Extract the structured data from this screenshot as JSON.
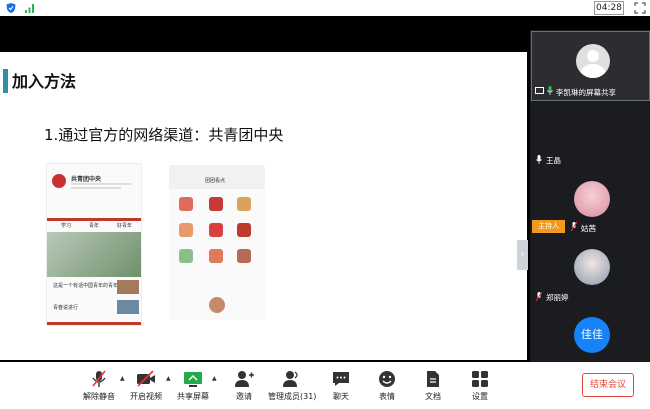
{
  "topbar": {
    "time": "04:28"
  },
  "slide": {
    "title": "加入方法",
    "subtitle": "1.通过官方的网络渠道：共青团中央",
    "phone1": {
      "account_name": "共青团中央",
      "tabs": [
        "学习",
        "青年",
        "好青年"
      ],
      "item1": "这是一个有话中国青年的青年情感",
      "item2": "青春说进行"
    },
    "phone2": {
      "title": "团团看点"
    }
  },
  "participants": [
    {
      "name": "李凯琳的屏幕共享"
    },
    {
      "name": "王晶"
    },
    {
      "name": "姑茜",
      "badge": "主持人"
    },
    {
      "name": "郑丽婷"
    },
    {
      "avatar_text": "佳佳"
    }
  ],
  "toolbar": {
    "mute": "解除静音",
    "video": "开启视频",
    "share": "共享屏幕",
    "invite": "邀请",
    "members": "管理成员(31)",
    "chat": "聊天",
    "emoji": "表情",
    "docs": "文档",
    "settings": "设置",
    "end": "结束会议"
  }
}
